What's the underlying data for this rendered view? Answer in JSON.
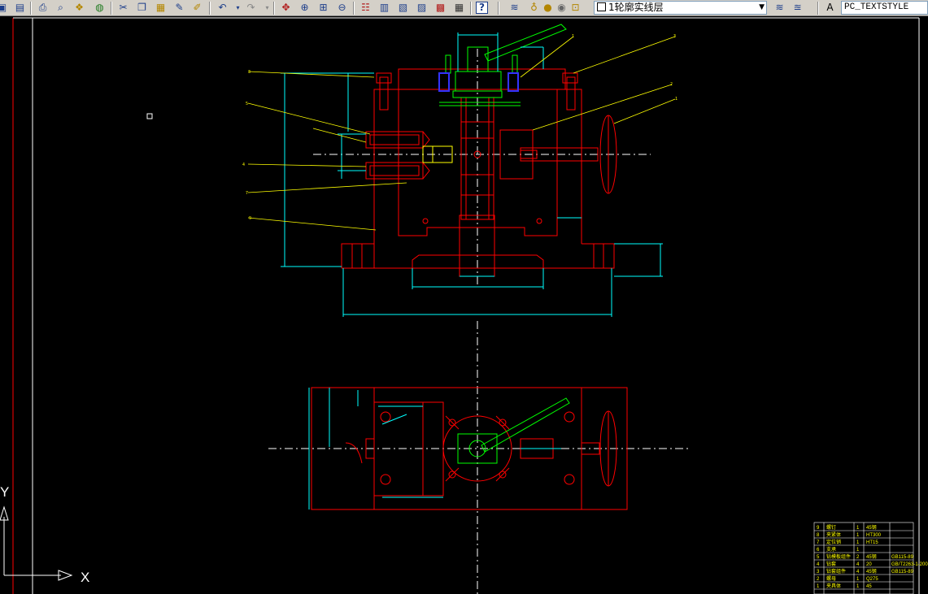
{
  "toolbar": {
    "buttons": [
      "save-icon",
      "print-icon",
      "print-preview-icon",
      "publish-icon",
      "3d-dwf-icon",
      "cut-icon",
      "copy-icon",
      "paste-icon",
      "match-properties-icon",
      "block-editor-icon",
      "undo-icon",
      "undo-dropdown-icon",
      "redo-icon",
      "redo-dropdown-icon",
      "pan-icon",
      "zoom-realtime-icon",
      "zoom-window-icon",
      "zoom-previous-icon",
      "properties-icon",
      "design-center-icon",
      "tool-palettes-icon",
      "sheet-set-icon",
      "markup-icon",
      "calculator-icon",
      "help-icon",
      "layer-manager-icon",
      "layer-on-icon",
      "layer-freeze-icon",
      "layer-lock-icon",
      "layer-color-icon"
    ],
    "layer_name": "1轮廓实线层",
    "text_style": "PC_TEXTSTYLE"
  },
  "ucs": {
    "y_label": "Y",
    "x_label": "X"
  },
  "bom": {
    "rows": [
      [
        "9",
        "螺钉",
        "1",
        "45钢",
        ""
      ],
      [
        "8",
        "夹紧体",
        "1",
        "HT300",
        ""
      ],
      [
        "7",
        "定位销",
        "1",
        "HT15",
        ""
      ],
      [
        "6",
        "支承",
        "1",
        "",
        ""
      ],
      [
        "5",
        "钻模板组件",
        "2",
        "45钢",
        "GB115-89"
      ],
      [
        "4",
        "钻套",
        "4",
        "20",
        "GB/T2263-1-2000"
      ],
      [
        "3",
        "钻套组件",
        "4",
        "45钢",
        "GB115-89"
      ],
      [
        "2",
        "螺母",
        "1",
        "Q275",
        ""
      ],
      [
        "1",
        "夹具体",
        "1",
        "45",
        ""
      ]
    ]
  },
  "colors": {
    "background": "#000000",
    "outline": "#ff0000",
    "dimension": "#00ffff",
    "leader": "#ffff00",
    "center": "#ffffff",
    "part": "#00ff00",
    "hatch": "#0000ff"
  }
}
